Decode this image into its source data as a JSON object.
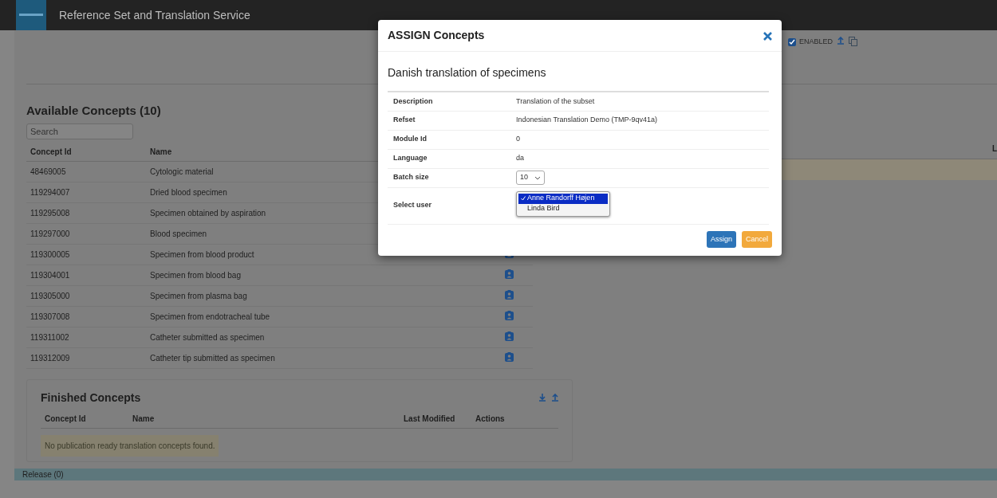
{
  "app": {
    "title": "Reference Set and Translation Service"
  },
  "toolbar": {
    "enabled_label": "ENABLED",
    "enabled_checked": true
  },
  "right_panel": {
    "column_1": "L"
  },
  "available": {
    "title": "Available Concepts (10)",
    "search": {
      "placeholder": "Search"
    },
    "columns": [
      "Concept Id",
      "Name"
    ],
    "rows": [
      {
        "id": "48469005",
        "name": "Cytologic material",
        "action_visible": false
      },
      {
        "id": "119294007",
        "name": "Dried blood specimen",
        "action_visible": false
      },
      {
        "id": "119295008",
        "name": "Specimen obtained by aspiration",
        "action_visible": false
      },
      {
        "id": "119297000",
        "name": "Blood specimen",
        "action_visible": false
      },
      {
        "id": "119300005",
        "name": "Specimen from blood product",
        "action_visible": true
      },
      {
        "id": "119304001",
        "name": "Specimen from blood bag",
        "action_visible": true
      },
      {
        "id": "119305000",
        "name": "Specimen from plasma bag",
        "action_visible": true
      },
      {
        "id": "119307008",
        "name": "Specimen from endotracheal tube",
        "action_visible": true
      },
      {
        "id": "119311002",
        "name": "Catheter submitted as specimen",
        "action_visible": true
      },
      {
        "id": "119312009",
        "name": "Catheter tip submitted as specimen",
        "action_visible": true
      }
    ]
  },
  "finished": {
    "title": "Finished Concepts",
    "columns": [
      "Concept Id",
      "Name",
      "Last Modified",
      "Actions"
    ],
    "empty_message": "No publication ready translation concepts found."
  },
  "release": {
    "title": "Release (0)"
  },
  "modal": {
    "title": "ASSIGN Concepts",
    "subtitle": "Danish translation of specimens",
    "fields": [
      {
        "label": "Description",
        "kind": "text",
        "value": "Translation of the subset"
      },
      {
        "label": "Refset",
        "kind": "text",
        "value": "Indonesian Translation Demo (TMP-9qv41a)"
      },
      {
        "label": "Module Id",
        "kind": "text",
        "value": "0"
      },
      {
        "label": "Language",
        "kind": "text",
        "value": "da"
      },
      {
        "label": "Batch size",
        "kind": "select",
        "value": "10"
      },
      {
        "label": "Select user",
        "kind": "list",
        "options": [
          {
            "label": "Anne Randorff Højen",
            "selected": true
          },
          {
            "label": "Linda Bird",
            "selected": false
          }
        ]
      }
    ],
    "buttons": [
      {
        "label": "Assign",
        "kind": "primary"
      },
      {
        "label": "Cancel",
        "kind": "cancel"
      }
    ]
  }
}
